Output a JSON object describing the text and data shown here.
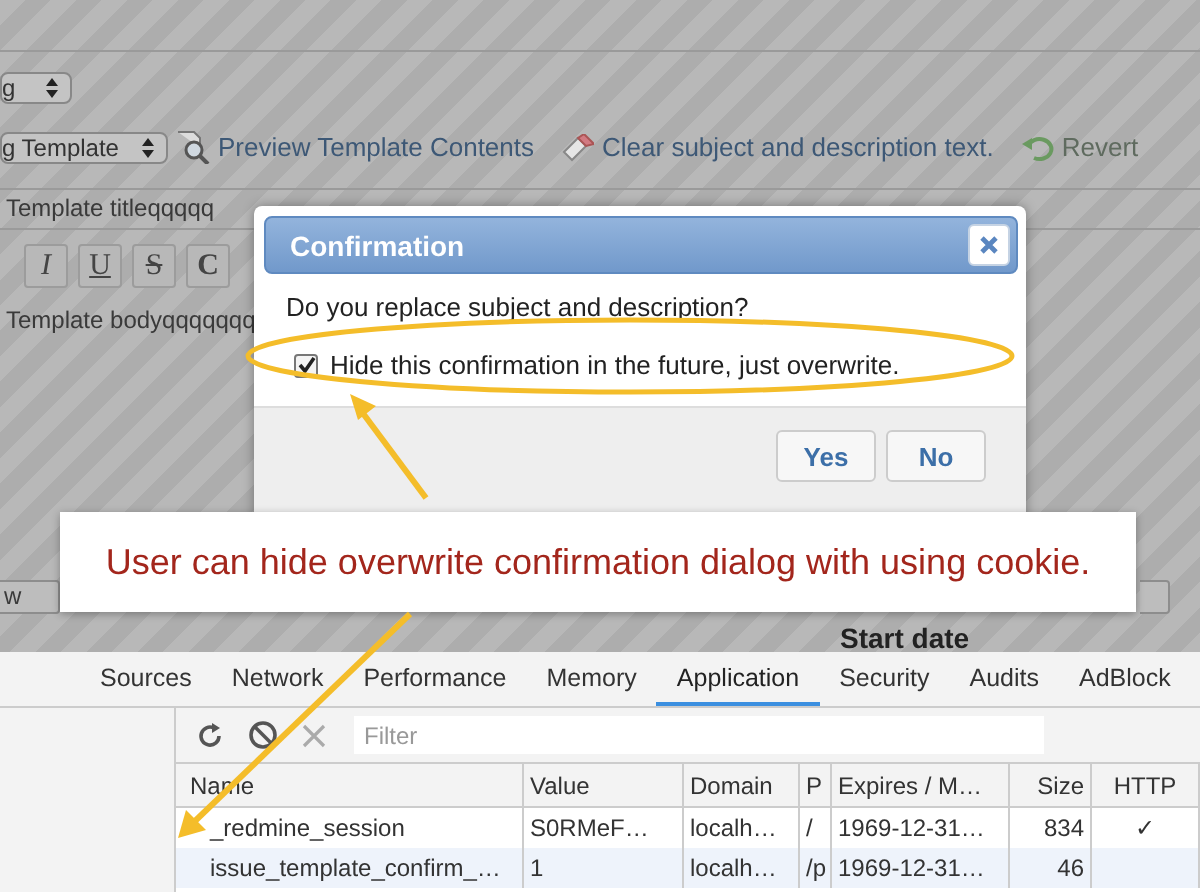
{
  "page": {
    "selects": [
      {
        "value": "g"
      },
      {
        "value": "g Template"
      }
    ],
    "toolbar_links": [
      {
        "kind": "preview",
        "label": "Preview Template Contents",
        "disabled": false
      },
      {
        "kind": "clear",
        "label": "Clear subject and description text.",
        "disabled": false
      },
      {
        "kind": "revert",
        "label": "Revert",
        "disabled": true
      }
    ],
    "subject": "Template titleqqqqq",
    "editor_buttons": [
      {
        "kind": "italic",
        "label": "I"
      },
      {
        "kind": "underline",
        "label": "U"
      },
      {
        "kind": "strike",
        "label": "S"
      },
      {
        "kind": "bold",
        "label": "C"
      }
    ],
    "body": "Template bodyqqqqqqq",
    "left_field": {
      "value": "w"
    },
    "start_date_label": "Start date"
  },
  "dialog": {
    "title": "Confirmation",
    "question": "Do you replace subject and description?",
    "checkbox": {
      "label": "Hide this confirmation in the future, just overwrite.",
      "checked": true
    },
    "buttons": [
      "Yes",
      "No"
    ]
  },
  "callout": {
    "text": "User can hide overwrite confirmation dialog with using cookie."
  },
  "devtools": {
    "tabs": [
      {
        "label": "Sources",
        "selected": false
      },
      {
        "label": "Network",
        "selected": false
      },
      {
        "label": "Performance",
        "selected": false
      },
      {
        "label": "Memory",
        "selected": false
      },
      {
        "label": "Application",
        "selected": true
      },
      {
        "label": "Security",
        "selected": false
      },
      {
        "label": "Audits",
        "selected": false
      },
      {
        "label": "AdBlock",
        "selected": false
      }
    ],
    "filter": {
      "placeholder": "Filter"
    },
    "table": {
      "columns": [
        "Name",
        "Value",
        "Domain",
        "P",
        "Expires / M…",
        "Size",
        "HTTP"
      ],
      "rows": [
        {
          "cells": [
            "_redmine_session",
            "S0RMeF…",
            "localh…",
            "/",
            "1969-12-31…",
            "834",
            "✓"
          ],
          "selected": false
        },
        {
          "cells": [
            "issue_template_confirm_…",
            "1",
            "localh…",
            "/p",
            "1969-12-31…",
            "46",
            ""
          ],
          "selected": true
        }
      ]
    }
  }
}
